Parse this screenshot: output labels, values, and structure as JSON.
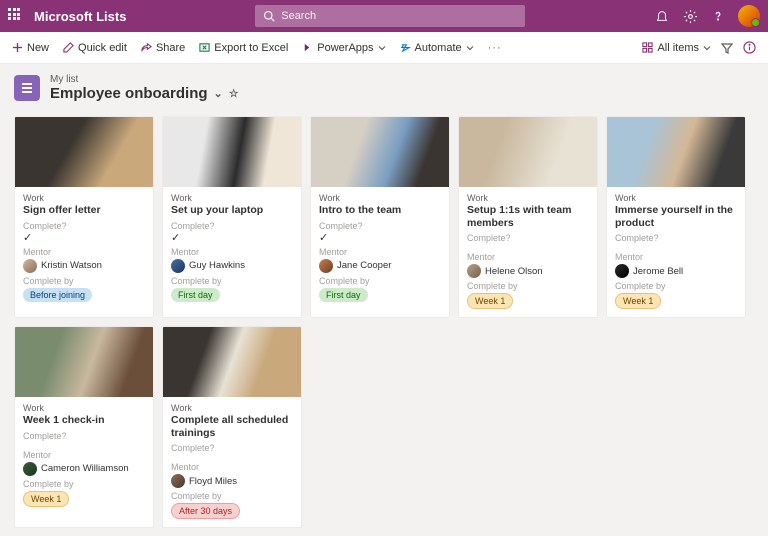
{
  "header": {
    "app_name": "Microsoft Lists",
    "search_placeholder": "Search"
  },
  "toolbar": {
    "new": "New",
    "quick_edit": "Quick edit",
    "share": "Share",
    "export": "Export to Excel",
    "powerapps": "PowerApps",
    "automate": "Automate",
    "all_items": "All items"
  },
  "list": {
    "breadcrumb": "My list",
    "title": "Employee onboarding"
  },
  "labels": {
    "complete": "Complete?",
    "mentor": "Mentor",
    "complete_by": "Complete by"
  },
  "cards": [
    {
      "category": "Work",
      "title": "Sign offer letter",
      "checked": true,
      "mentor": "Kristin Watson",
      "complete_by": "Before joining",
      "tag_class": "tag-blue"
    },
    {
      "category": "Work",
      "title": "Set up your laptop",
      "checked": true,
      "mentor": "Guy Hawkins",
      "complete_by": "First day",
      "tag_class": "tag-green"
    },
    {
      "category": "Work",
      "title": "Intro to the team",
      "checked": true,
      "mentor": "Jane Cooper",
      "complete_by": "First day",
      "tag_class": "tag-green"
    },
    {
      "category": "Work",
      "title": "Setup 1:1s with team members",
      "checked": false,
      "mentor": "Helene Olson",
      "complete_by": "Week 1",
      "tag_class": "tag-yellow"
    },
    {
      "category": "Work",
      "title": "Immerse yourself in the product",
      "checked": false,
      "mentor": "Jerome Bell",
      "complete_by": "Week 1",
      "tag_class": "tag-yellow"
    },
    {
      "category": "Work",
      "title": "Week 1 check-in",
      "checked": false,
      "mentor": "Cameron Williamson",
      "complete_by": "Week 1",
      "tag_class": "tag-yellow"
    },
    {
      "category": "Work",
      "title": "Complete all scheduled trainings",
      "checked": false,
      "mentor": "Floyd Miles",
      "complete_by": "After 30 days",
      "tag_class": "tag-red"
    }
  ]
}
